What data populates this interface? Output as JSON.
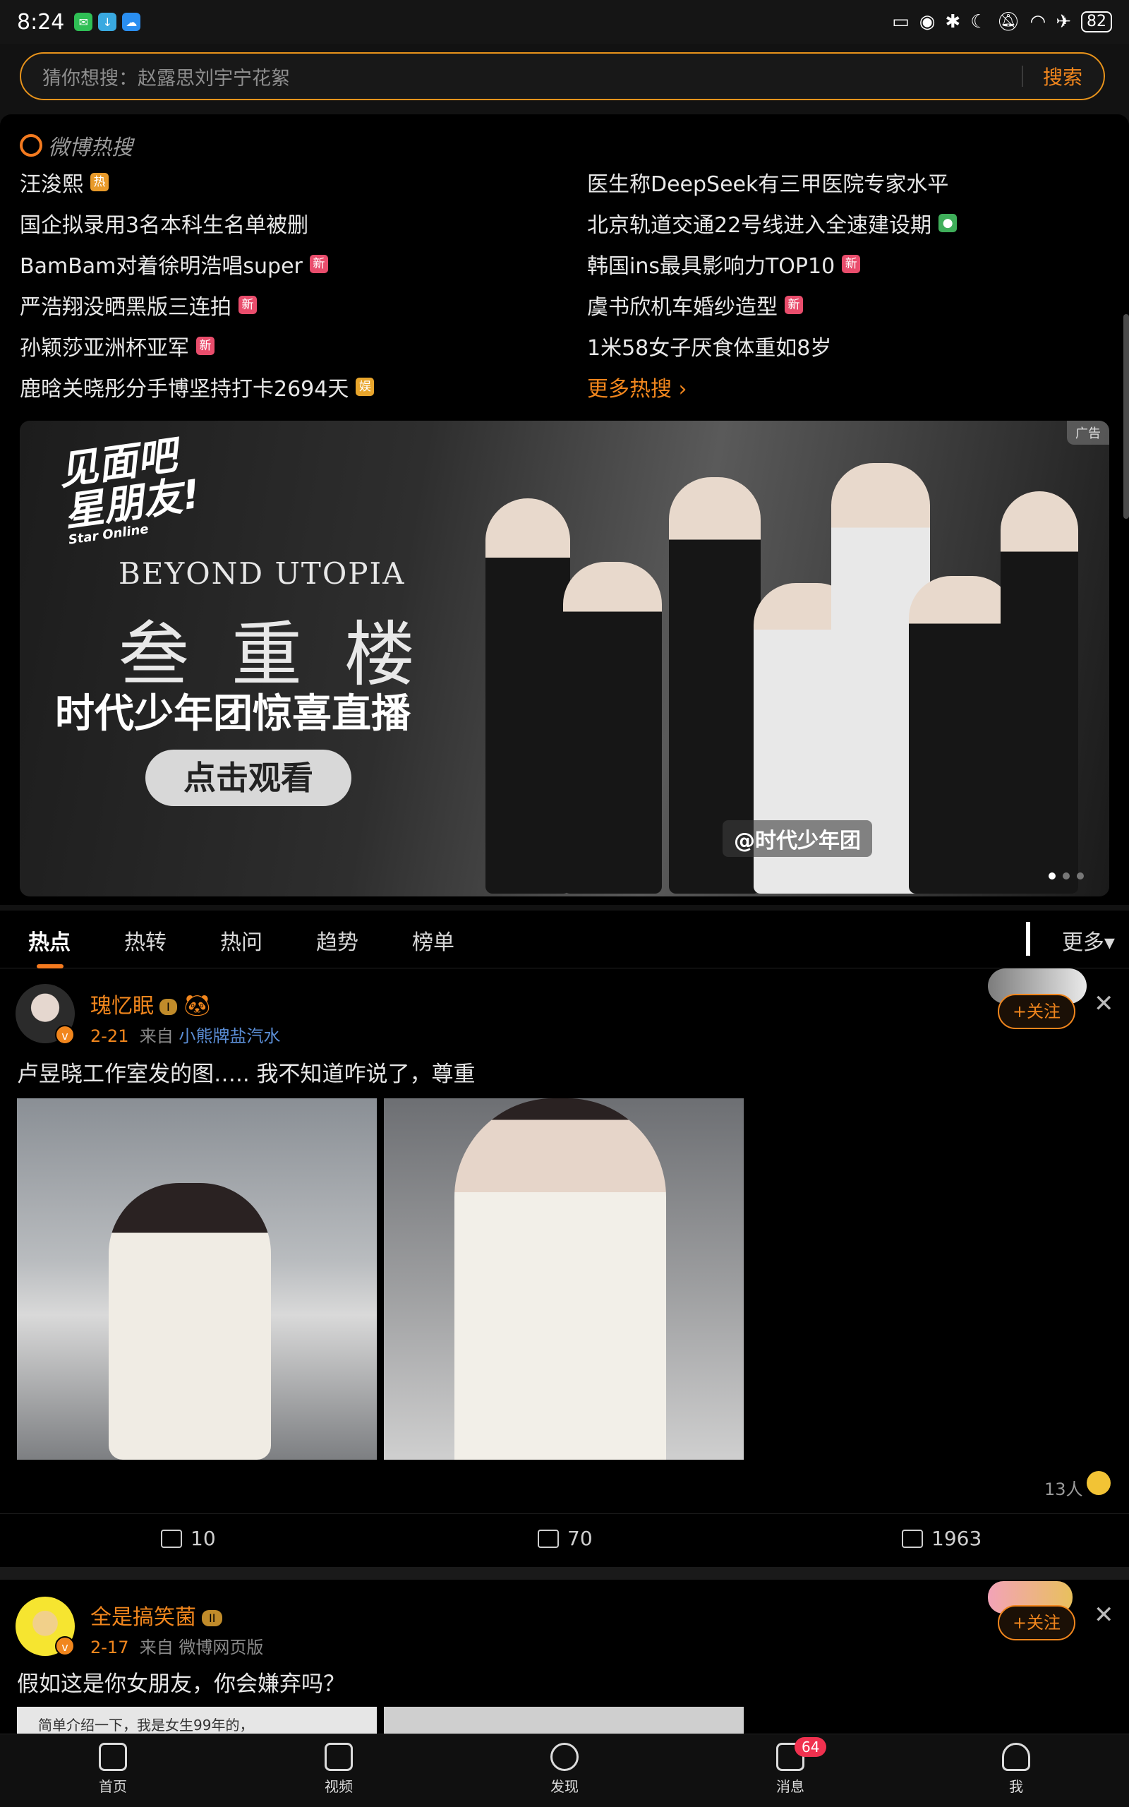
{
  "status": {
    "time": "8:24",
    "battery": "82"
  },
  "search": {
    "placeholder": "猜你想搜：赵露思刘宇宁花絮",
    "button": "搜索"
  },
  "hot_search": {
    "logo": "微博热搜",
    "left": [
      {
        "text": "汪浚熙",
        "badge": "热"
      },
      {
        "text": "国企拟录用3名本科生名单被删",
        "badge": ""
      },
      {
        "text": "BamBam对着徐明浩唱super",
        "badge": "新"
      },
      {
        "text": "严浩翔没晒黑版三连拍",
        "badge": "新"
      },
      {
        "text": "孙颖莎亚洲杯亚军",
        "badge": "新"
      },
      {
        "text": "鹿晗关晓彤分手博坚持打卡2694天",
        "badge": "娱"
      }
    ],
    "right": [
      {
        "text": "医生称DeepSeek有三甲医院专家水平",
        "badge": ""
      },
      {
        "text": "北京轨道交通22号线进入全速建设期",
        "badge": "●"
      },
      {
        "text": "韩国ins最具影响力TOP10",
        "badge": "新"
      },
      {
        "text": "虞书欣机车婚纱造型",
        "badge": "新"
      },
      {
        "text": "1米58女子厌食体重如8岁",
        "badge": ""
      }
    ],
    "more": "更多热搜 ›"
  },
  "banner": {
    "ad": "广告",
    "logo_line1": "见面吧",
    "logo_line2": "星朋友!",
    "logo_sub": "Star Online",
    "beyond": "BEYOND UTOPIA",
    "tower": "叁重楼",
    "live": "时代少年团惊喜直播",
    "watch": "点击观看",
    "handle": "@时代少年团"
  },
  "tabs": {
    "items": [
      "热点",
      "热转",
      "热问",
      "趋势",
      "榜单"
    ],
    "more": "更多▾"
  },
  "posts": [
    {
      "user": "瑰忆眠",
      "level": "I",
      "date": "2-21",
      "from": "来自",
      "source": "小熊牌盐汽水",
      "text": "卢昱晓工作室发的图….. 我不知道咋说了，尊重",
      "follow": "+关注",
      "reactions": "13人",
      "repost": "10",
      "comment": "70",
      "like": "1963"
    },
    {
      "user": "全是搞笑菌",
      "level": "II",
      "date": "2-17",
      "from": "来自",
      "source": "微博网页版",
      "text": "假如这是你女朋友，你会嫌弃吗？",
      "follow": "+关注",
      "thumb_text": "简单介绍一下，我是女生99年的，"
    }
  ],
  "bottom_nav": [
    {
      "label": "首页"
    },
    {
      "label": "视频"
    },
    {
      "label": "发现"
    },
    {
      "label": "消息",
      "badge": "64"
    },
    {
      "label": "我"
    }
  ]
}
